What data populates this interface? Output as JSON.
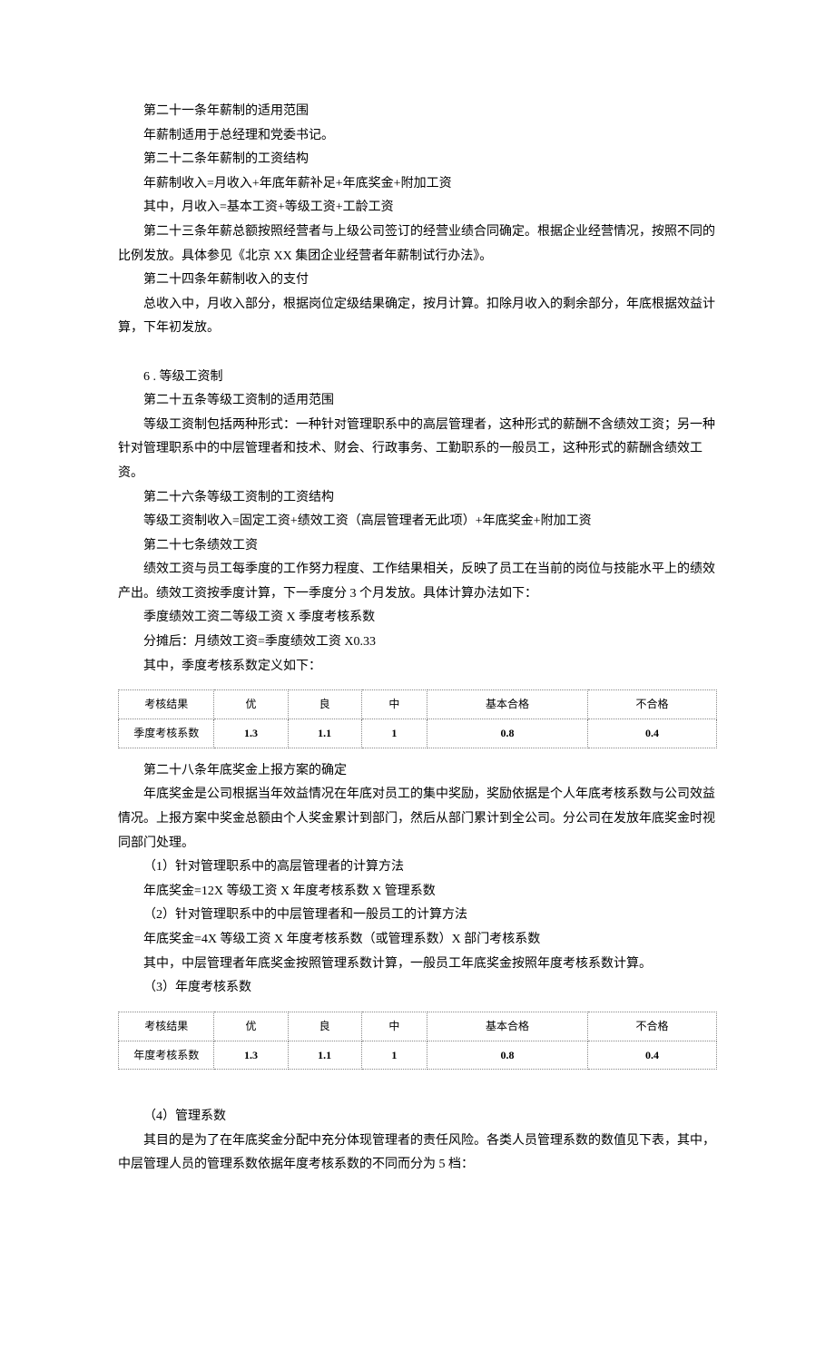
{
  "paragraphs": {
    "p01": "第二十一条年薪制的适用范围",
    "p02": "年薪制适用于总经理和党委书记。",
    "p03": "第二十二条年薪制的工资结构",
    "p04": "年薪制收入=月收入+年底年薪补足+年底奖金+附加工资",
    "p05": "其中，月收入=基本工资+等级工资+工龄工资",
    "p06": "第二十三条年薪总额按照经营者与上级公司签订的经营业绩合同确定。根据企业经营情况，按照不同的比例发放。具体参见《北京 XX 集团企业经营者年薪制试行办法》。",
    "p07": "第二十四条年薪制收入的支付",
    "p08": "总收入中，月收入部分，根据岗位定级结果确定，按月计算。扣除月收入的剩余部分，年底根据效益计算，下年初发放。",
    "p09": "6 . 等级工资制",
    "p10": "第二十五条等级工资制的适用范围",
    "p11": "等级工资制包括两种形式：一种针对管理职系中的高层管理者，这种形式的薪酬不含绩效工资；另一种针对管理职系中的中层管理者和技术、财会、行政事务、工勤职系的一般员工，这种形式的薪酬含绩效工资。",
    "p12": "第二十六条等级工资制的工资结构",
    "p13": "等级工资制收入=固定工资+绩效工资（高层管理者无此项）+年底奖金+附加工资",
    "p14": "第二十七条绩效工资",
    "p15": "绩效工资与员工每季度的工作努力程度、工作结果相关，反映了员工在当前的岗位与技能水平上的绩效产出。绩效工资按季度计算，下一季度分 3 个月发放。具体计算办法如下：",
    "p16": "季度绩效工资二等级工资 X 季度考核系数",
    "p17": "分摊后：月绩效工资=季度绩效工资 X0.33",
    "p18": "其中，季度考核系数定义如下：",
    "p19": "第二十八条年底奖金上报方案的确定",
    "p20": "年底奖金是公司根据当年效益情况在年底对员工的集中奖励，奖励依据是个人年底考核系数与公司效益情况。上报方案中奖金总额由个人奖金累计到部门，然后从部门累计到全公司。分公司在发放年底奖金时视同部门处理。",
    "p21": "（1）针对管理职系中的高层管理者的计算方法",
    "p22": "年底奖金=12X 等级工资 X 年度考核系数 X 管理系数",
    "p23": "（2）针对管理职系中的中层管理者和一般员工的计算方法",
    "p24": "年底奖金=4X 等级工资 X 年度考核系数（或管理系数）X 部门考核系数",
    "p25": "其中，中层管理者年底奖金按照管理系数计算，一般员工年底奖金按照年度考核系数计算。",
    "p26": "（3）年度考核系数",
    "p27": "（4）管理系数",
    "p28": "其目的是为了在年底奖金分配中充分体现管理者的责任风险。各类人员管理系数的数值见下表，其中，中层管理人员的管理系数依据年度考核系数的不同而分为 5 档："
  },
  "chart_data": [
    {
      "type": "table",
      "title": "季度考核系数",
      "rows": [
        {
          "label": "考核结果",
          "values": [
            "优",
            "良",
            "中",
            "基本合格",
            "不合格"
          ]
        },
        {
          "label": "季度考核系数",
          "values": [
            "1.3",
            "1.1",
            "1",
            "0.8",
            "0.4"
          ]
        }
      ]
    },
    {
      "type": "table",
      "title": "年度考核系数",
      "rows": [
        {
          "label": "考核结果",
          "values": [
            "优",
            "良",
            "中",
            "基本合格",
            "不合格"
          ]
        },
        {
          "label": "年度考核系数",
          "values": [
            "1.3",
            "1.1",
            "1",
            "0.8",
            "0.4"
          ]
        }
      ]
    }
  ]
}
